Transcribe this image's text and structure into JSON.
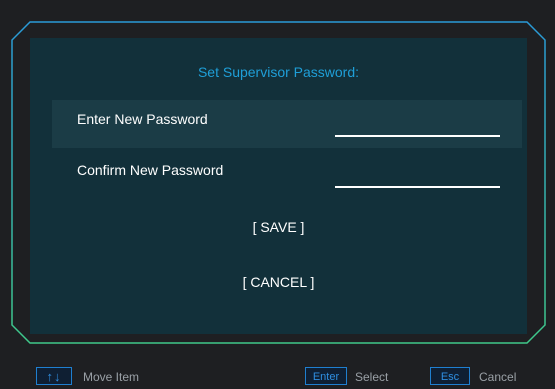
{
  "dialog": {
    "title": "Set Supervisor Password:",
    "fields": [
      {
        "label": "Enter New Password",
        "value": ""
      },
      {
        "label": "Confirm New Password",
        "value": ""
      }
    ],
    "save_label": "[ SAVE ]",
    "cancel_label": "[ CANCEL ]"
  },
  "footer": {
    "move_key": "↑↓",
    "move_label": "Move Item",
    "select_key": "Enter",
    "select_label": "Select",
    "cancel_key": "Esc",
    "cancel_label": "Cancel"
  },
  "colors": {
    "accent": "#1f9fd8",
    "panel": "#12303a",
    "selected_row": "#1b3c46",
    "frame_top": "#2a9ad8",
    "frame_bottom": "#3fc98a",
    "background": "#1e1f22"
  }
}
